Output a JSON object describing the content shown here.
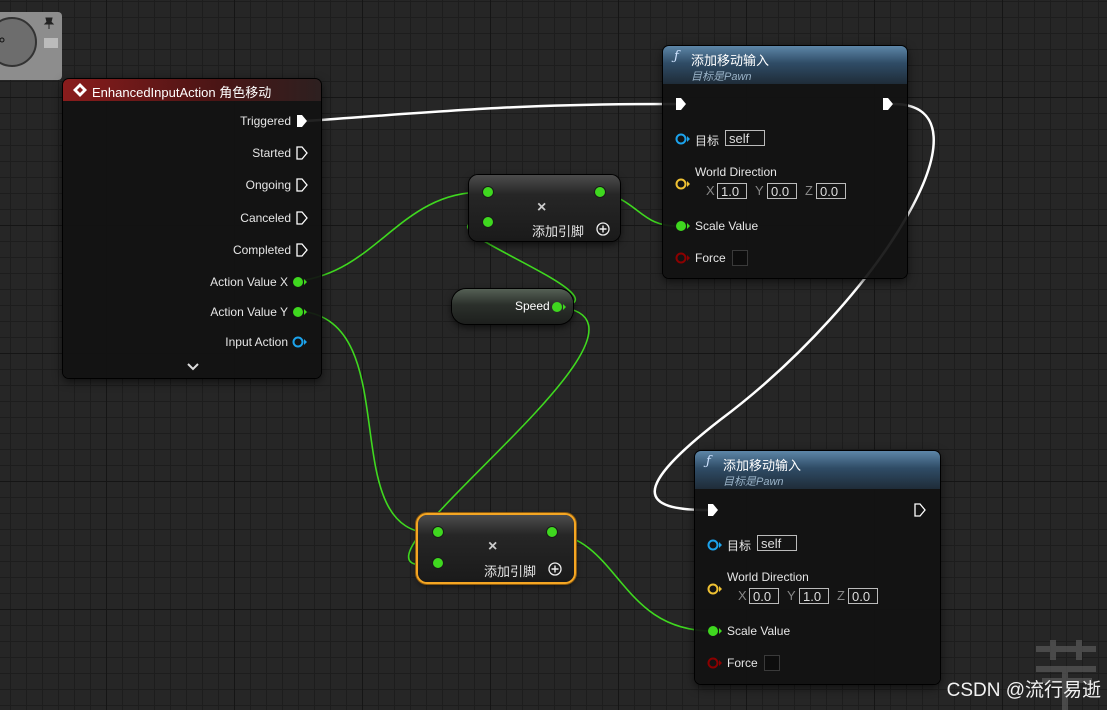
{
  "colors": {
    "exec": "#ffffff",
    "float": "#3fd81f",
    "object": "#1ca3ec",
    "vector": "#f0c233",
    "struct": "#8a1c1c",
    "selected": "#f5a623"
  },
  "icons": {
    "event": "diamond-event-icon",
    "function": "function-f-icon",
    "add_pin": "circle-plus-icon",
    "remove": "x-icon",
    "expand": "chevron-down-icon",
    "pin": "pushpin-icon"
  },
  "event_node": {
    "title": "EnhancedInputAction 角色移动",
    "outputs": [
      "Triggered",
      "Started",
      "Ongoing",
      "Canceled",
      "Completed",
      "Action Value X",
      "Action Value Y",
      "Input Action"
    ]
  },
  "add_node_top": {
    "label": "添加引脚",
    "symbol": "×"
  },
  "add_node_bottom": {
    "label": "添加引脚",
    "symbol": "×"
  },
  "speed_node": {
    "label": "Speed"
  },
  "func_node_top": {
    "title": "添加移动输入",
    "subtitle": "目标是Pawn",
    "target_label": "目标",
    "target_value": "self",
    "direction_label": "World Direction",
    "x_label": "X",
    "y_label": "Y",
    "z_label": "Z",
    "x": "1.0",
    "y": "0.0",
    "z": "0.0",
    "scale_label": "Scale Value",
    "force_label": "Force"
  },
  "func_node_bottom": {
    "title": "添加移动输入",
    "subtitle": "目标是Pawn",
    "target_label": "目标",
    "target_value": "self",
    "direction_label": "World Direction",
    "x_label": "X",
    "y_label": "Y",
    "z_label": "Z",
    "x": "0.0",
    "y": "1.0",
    "z": "0.0",
    "scale_label": "Scale Value",
    "force_label": "Force"
  },
  "watermark": "CSDN @流行易逝"
}
